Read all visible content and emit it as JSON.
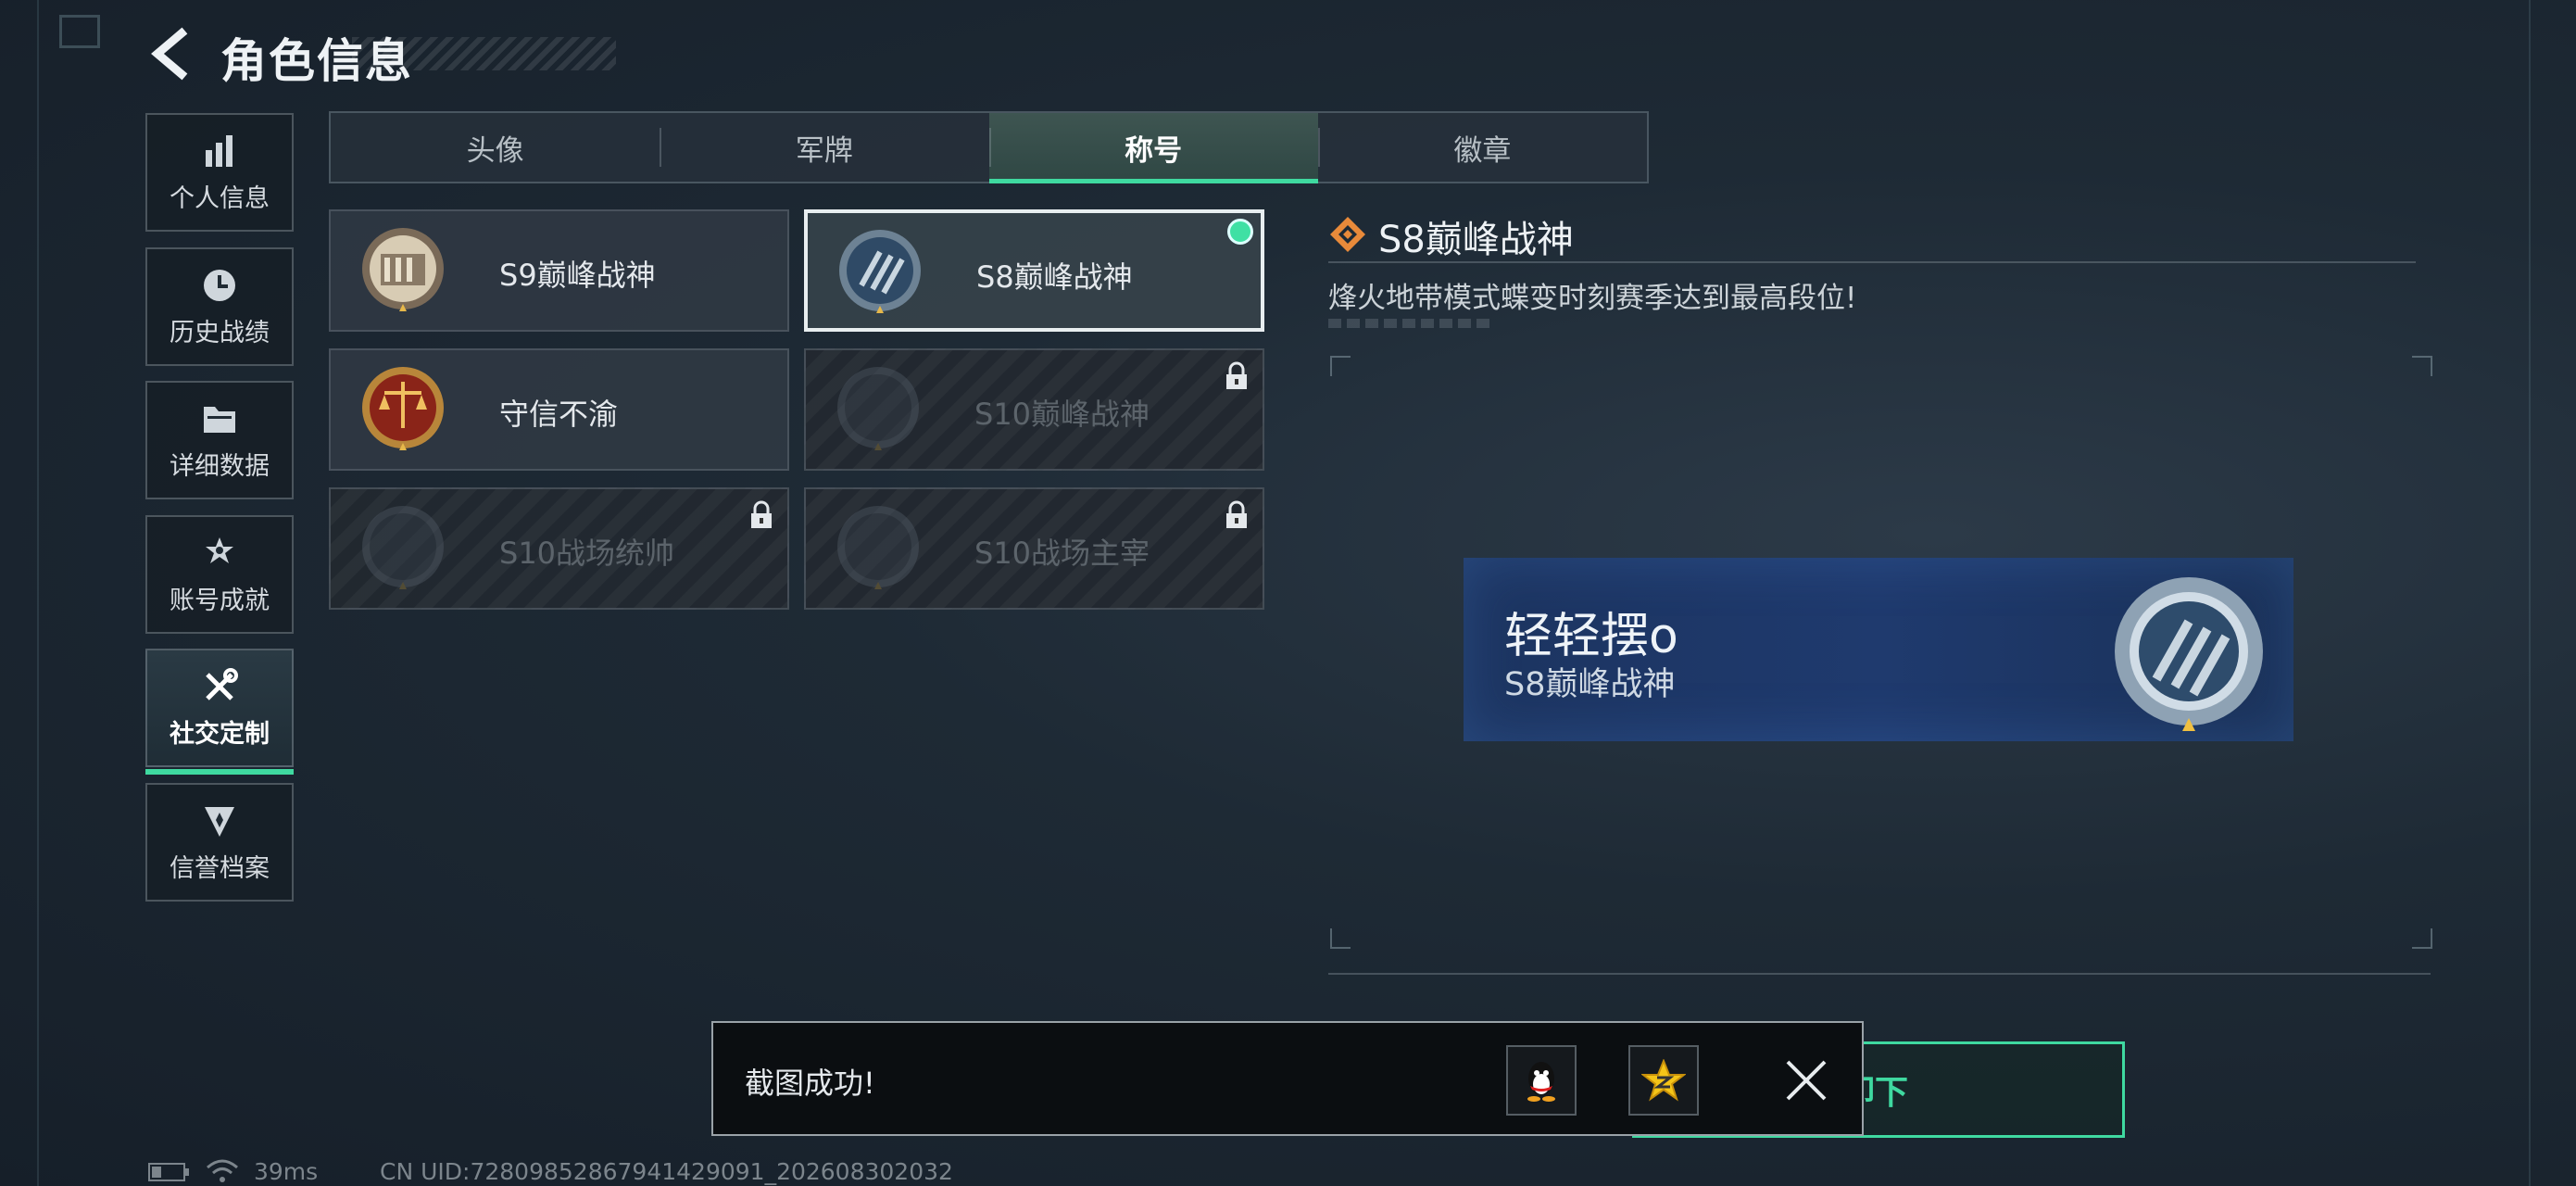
{
  "header": {
    "title": "角色信息"
  },
  "sidebar": {
    "items": [
      {
        "label": "个人信息",
        "icon": "bar-chart-icon"
      },
      {
        "label": "历史战绩",
        "icon": "clock-icon"
      },
      {
        "label": "详细数据",
        "icon": "folder-icon"
      },
      {
        "label": "账号成就",
        "icon": "medal-icon"
      },
      {
        "label": "社交定制",
        "icon": "tools-icon",
        "active": true
      },
      {
        "label": "信誉档案",
        "icon": "shield-icon"
      }
    ]
  },
  "tabs": [
    {
      "label": "头像"
    },
    {
      "label": "军牌"
    },
    {
      "label": "称号",
      "active": true
    },
    {
      "label": "徽章"
    }
  ],
  "titles": [
    {
      "name": "S9巅峰战神",
      "locked": false
    },
    {
      "name": "S8巅峰战神",
      "locked": false,
      "selected": true,
      "equipped": true
    },
    {
      "name": "守信不渝",
      "locked": false
    },
    {
      "name": "S10巅峰战神",
      "locked": true
    },
    {
      "name": "S10战场统帅",
      "locked": true
    },
    {
      "name": "S10战场主宰",
      "locked": true
    }
  ],
  "detail": {
    "title": "S8巅峰战神",
    "description": "烽火地带模式蝶变时刻赛季达到最高段位!"
  },
  "preview": {
    "player_name": "轻轻摆o",
    "title": "S8巅峰战神"
  },
  "action": {
    "unequip_label": "卸下"
  },
  "toast": {
    "message": "截图成功!"
  },
  "status": {
    "ping": "39ms",
    "uid": "CN UID:7280985286794142909​1_202608302032"
  },
  "colors": {
    "accent": "#3fd9a0",
    "background": "#1e2a35",
    "preview_bg": "#1f3a6e"
  }
}
